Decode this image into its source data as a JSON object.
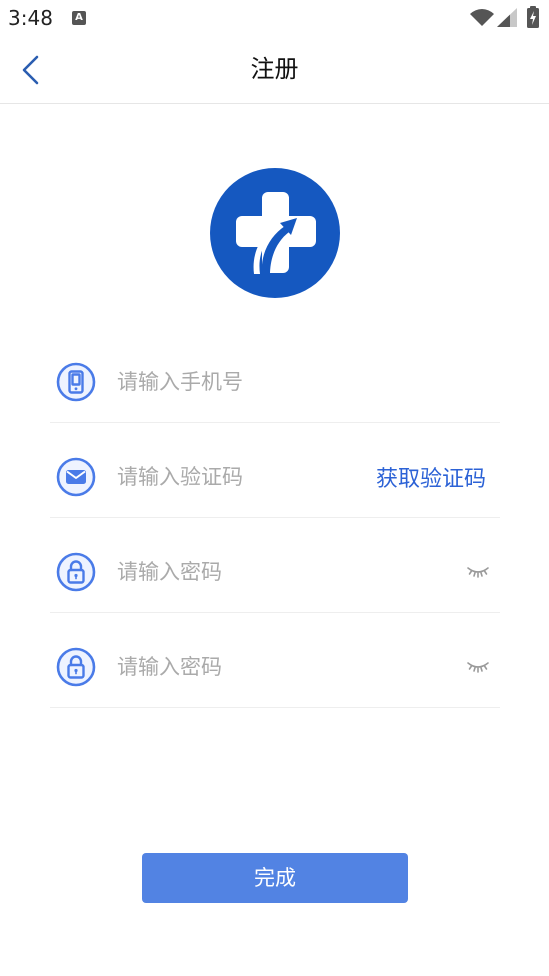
{
  "status_bar": {
    "time": "3:48",
    "notification": {
      "icon": "text-a-notification-icon",
      "glyph": "A"
    },
    "icons": [
      "wifi-icon",
      "cell-signal-icon",
      "battery-charging-icon"
    ]
  },
  "header": {
    "back_icon": "chevron-left-icon",
    "title": "注册"
  },
  "logo": {
    "icon": "medical-cross-arrow-logo"
  },
  "form": {
    "phone": {
      "icon": "phone-icon",
      "placeholder": "请输入手机号",
      "value": ""
    },
    "sms_code": {
      "icon": "mail-icon",
      "placeholder": "请输入验证码",
      "value": "",
      "get_code_label": "获取验证码"
    },
    "password": {
      "icon": "lock-icon",
      "placeholder": "请输入密码",
      "value": "",
      "visibility_icon": "eye-closed-icon"
    },
    "confirm_password": {
      "icon": "lock-icon",
      "placeholder": "请输入密码",
      "value": "",
      "visibility_icon": "eye-closed-icon"
    }
  },
  "submit": {
    "label": "完成"
  },
  "colors": {
    "logo_blue": "#1558C0",
    "icon_blue": "#4A7BE8",
    "link_blue": "#2C62D6",
    "button_blue": "#5283E3",
    "back_blue": "#2A5DB0",
    "placeholder_gray": "#AAAAAA",
    "divider_gray": "#EEEEEE"
  }
}
